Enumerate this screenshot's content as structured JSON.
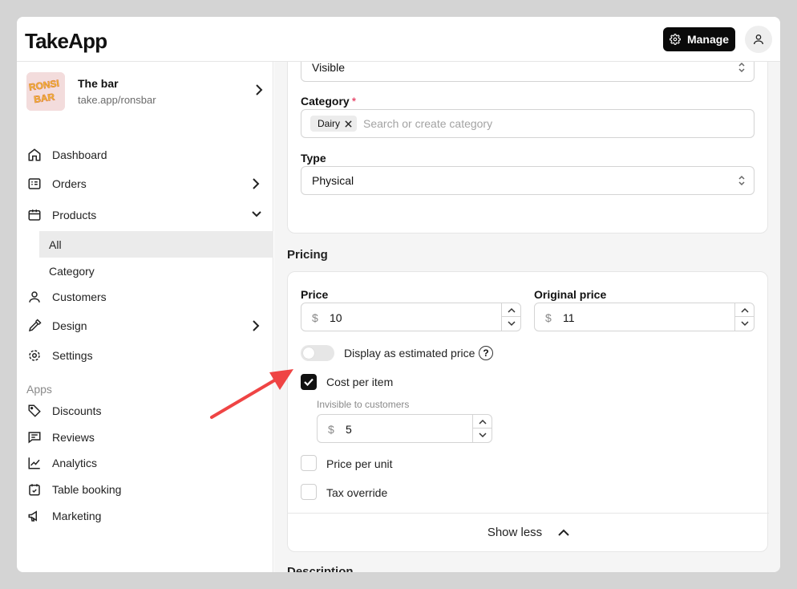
{
  "app": {
    "logo": "TakeApp",
    "manage_label": "Manage"
  },
  "store": {
    "name": "The bar",
    "url": "take.app/ronsbar",
    "thumb_text": "RONSI\nBAR"
  },
  "nav": {
    "dashboard": "Dashboard",
    "orders": "Orders",
    "products": "Products",
    "products_sub": {
      "all": "All",
      "category": "Category"
    },
    "customers": "Customers",
    "design": "Design",
    "settings": "Settings",
    "apps_title": "Apps",
    "discounts": "Discounts",
    "reviews": "Reviews",
    "analytics": "Analytics",
    "table_booking": "Table booking",
    "marketing": "Marketing"
  },
  "form": {
    "visibility_value": "Visible",
    "category_label": "Category",
    "category_required": "*",
    "category_chip": "Dairy",
    "category_placeholder": "Search or create category",
    "type_label": "Type",
    "type_value": "Physical"
  },
  "pricing": {
    "title": "Pricing",
    "price_label": "Price",
    "price_value": "10",
    "original_label": "Original price",
    "original_value": "11",
    "currency": "$",
    "estimated_label": "Display as estimated price",
    "estimated_on": false,
    "help_glyph": "?",
    "cost_label": "Cost per item",
    "cost_checked": true,
    "cost_hint": "Invisible to customers",
    "cost_value": "5",
    "per_unit_label": "Price per unit",
    "tax_label": "Tax override",
    "show_less": "Show less"
  },
  "description_title": "Description",
  "annotation": {
    "arrow_color": "#ef4444"
  }
}
